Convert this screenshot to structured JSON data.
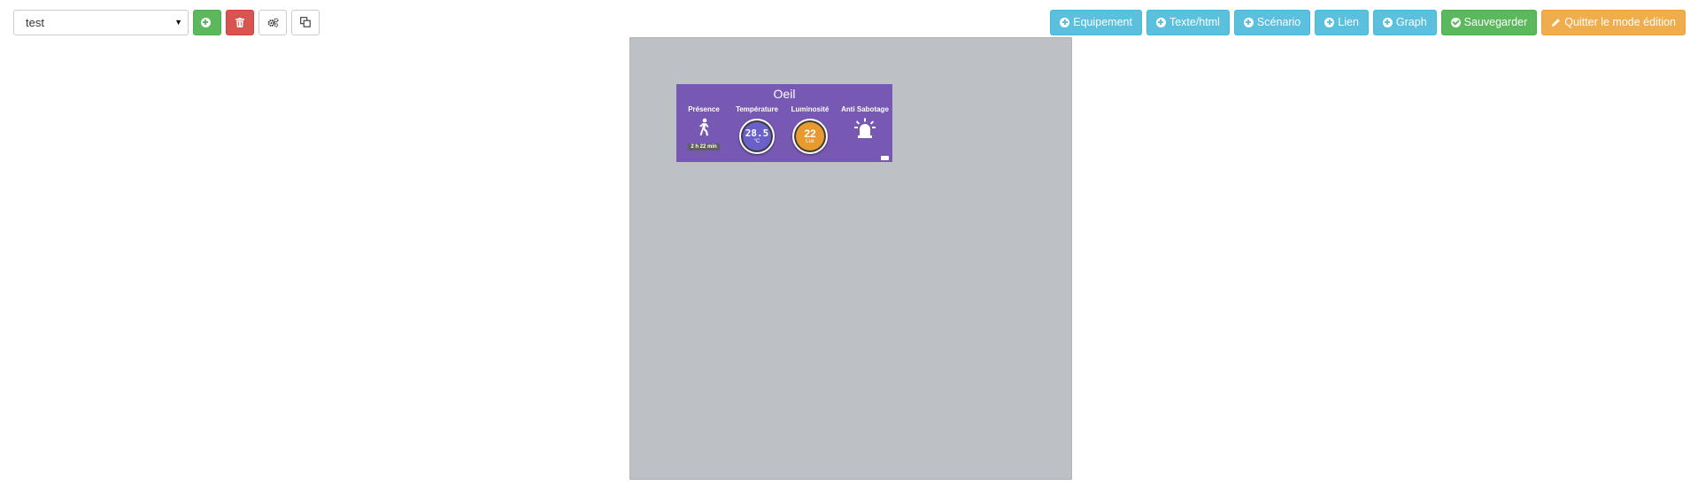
{
  "toolbar": {
    "plan_select_value": "test",
    "add_label": "",
    "delete_label": "",
    "configure_label": "",
    "duplicate_label": ""
  },
  "actions": {
    "equipement": "Equipement",
    "texte_html": "Texte/html",
    "scenario": "Scénario",
    "lien": "Lien",
    "graph": "Graph",
    "sauvegarder": "Sauvegarder",
    "quitter": "Quitter le mode édition"
  },
  "widget": {
    "title": "Oeil",
    "commands": [
      {
        "label": "Présence",
        "value": "2 h 22 min",
        "icon": "walking-person-icon"
      },
      {
        "label": "Température",
        "value": "28.5",
        "unit": "°C"
      },
      {
        "label": "Luminosité",
        "value": "22",
        "unit": "Lux"
      },
      {
        "label": "Anti Sabotage",
        "icon": "alarm-siren-icon"
      }
    ]
  },
  "colors": {
    "widget_background": "#7758b3",
    "plan_background": "#bdc1c5",
    "info": "#5bc0de",
    "success": "#5cb85c",
    "danger": "#d9534f",
    "warning": "#f0ad4e"
  }
}
